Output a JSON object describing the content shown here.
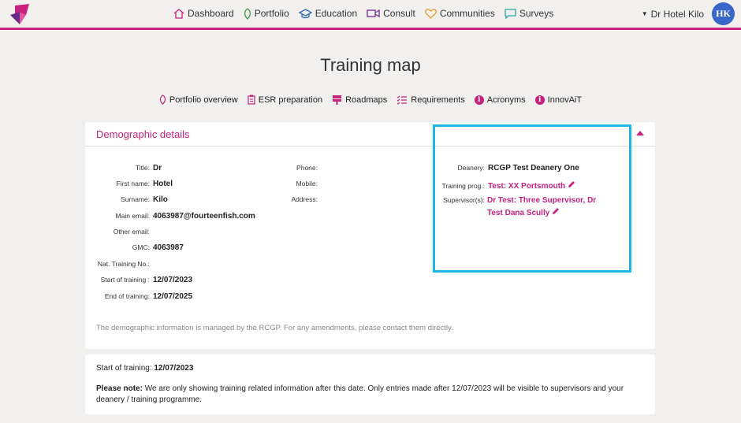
{
  "nav": {
    "items": [
      {
        "label": "Dashboard",
        "icon": "home-icon"
      },
      {
        "label": "Portfolio",
        "icon": "leaf-icon"
      },
      {
        "label": "Education",
        "icon": "graduation-cap-icon"
      },
      {
        "label": "Consult",
        "icon": "video-icon"
      },
      {
        "label": "Communities",
        "icon": "heart-icon"
      },
      {
        "label": "Surveys",
        "icon": "message-icon"
      }
    ],
    "user_name": "Dr Hotel Kilo",
    "avatar_initials": "HK"
  },
  "page": {
    "title": "Training map"
  },
  "subnav": {
    "items": [
      {
        "label": "Portfolio overview",
        "icon": "leaf-icon"
      },
      {
        "label": "ESR preparation",
        "icon": "clipboard-icon"
      },
      {
        "label": "Roadmaps",
        "icon": "signpost-icon"
      },
      {
        "label": "Requirements",
        "icon": "checklist-icon"
      },
      {
        "label": "Acronyms",
        "icon": "info-icon"
      },
      {
        "label": "InnovAiT",
        "icon": "info-icon"
      }
    ]
  },
  "demographics": {
    "heading": "Demographic details",
    "left": [
      {
        "label": "Title:",
        "value": "Dr"
      },
      {
        "label": "First name:",
        "value": "Hotel"
      },
      {
        "label": "Surname:",
        "value": "Kilo"
      },
      {
        "label": "Main email:",
        "value": "4063987@fourteenfish.com"
      },
      {
        "label": "Other email:",
        "value": ""
      },
      {
        "label": "GMC:",
        "value": "4063987"
      },
      {
        "label": "Nat. Training No.:",
        "value": ""
      },
      {
        "label": "Start of training :",
        "value": "12/07/2023"
      },
      {
        "label": "End of training:",
        "value": "12/07/2025"
      }
    ],
    "middle": [
      {
        "label": "Phone:",
        "value": ""
      },
      {
        "label": "Mobile:",
        "value": ""
      },
      {
        "label": "Address:",
        "value": ""
      }
    ],
    "deanery_label": "Deanery:",
    "deanery_value": "RCGP Test Deanery One",
    "programme_label": "Training prog.:",
    "programme_value": "Test: XX Portsmouth",
    "supervisors_label": "Supervisor(s):",
    "supervisors_line1": "Dr Test: Three Supervisor, Dr",
    "supervisors_line2": "Test Dana Scully",
    "note": "The demographic information is managed by the RCGP. For any amendments, please contact them directly."
  },
  "training_info": {
    "start_label": "Start of training:",
    "start_value": "12/07/2023",
    "note_label": "Please note:",
    "note_text": "We are only showing training related information after this date. Only entries made after 12/07/2023 will be visible to supervisors and your deanery / training programme."
  },
  "colors": {
    "accent": "#c8217f",
    "highlight": "#1cb5ea",
    "avatar": "#3a66c9"
  }
}
